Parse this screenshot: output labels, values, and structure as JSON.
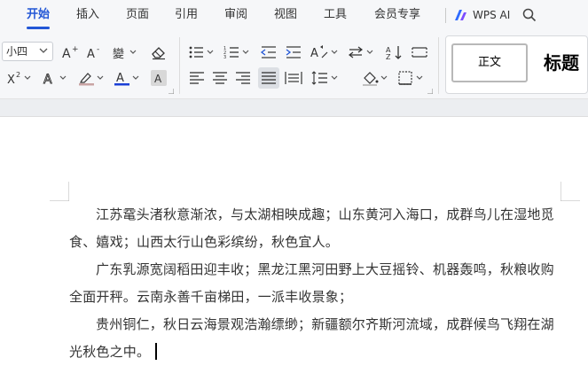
{
  "menu": {
    "items": [
      "开始",
      "插入",
      "页面",
      "引用",
      "审阅",
      "视图",
      "工具",
      "会员专享"
    ],
    "active": "开始",
    "ai_label": "WPS AI"
  },
  "ribbon": {
    "font_size": "小四",
    "styles": {
      "normal": "正文",
      "heading": "标题"
    }
  },
  "document": {
    "paragraphs": [
      "江苏鼋头渚秋意渐浓，与太湖相映成趣；山东黄河入海口，成群鸟儿在湿地觅食、嬉戏；山西太行山色彩缤纷，秋色宜人。",
      "广东乳源宽阔稻田迎丰收；黑龙江黑河田野上大豆摇铃、机器轰鸣，秋粮收购全面开秤。云南永善千亩梯田，一派丰收景象；",
      "贵州铜仁，秋日云海景观浩瀚缥缈；新疆额尔齐斯河流域，成群候鸟飞翔在湖光秋色之中。"
    ]
  },
  "colors": {
    "accent": "#2357d6",
    "font_color_bar": "#1a3fd6",
    "highlight_bar": "#c9a4a4"
  }
}
